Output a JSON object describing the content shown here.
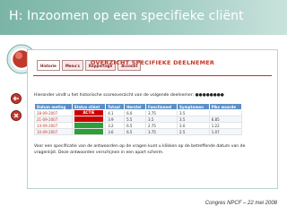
{
  "slide": {
    "title": "H: Inzoomen op een specifieke cliënt",
    "footer": "Congres  NPCF – 22  mei 2008"
  },
  "app": {
    "heading": "OVERZICHT SPECIFIEKE DEELNEMER",
    "tabs": [
      {
        "label": "Historie",
        "active": true
      },
      {
        "label": "Menu's",
        "active": false
      },
      {
        "label": "Rapportage",
        "active": false
      },
      {
        "label": "Account",
        "active": false
      }
    ],
    "intro": "Hieronder vindt u het historische scoreoverzicht van de volgende deelnemer:",
    "participant": "●●●●●●●●",
    "table": {
      "headers": [
        "Datum meting",
        "Status cliënt",
        "Totaal",
        "Herstel",
        "Functioneel",
        "Symptomen",
        "Piks waarde"
      ],
      "rows": [
        {
          "date": "28-09-2007",
          "status_label": "ACTIE",
          "status_color": "#cc0000",
          "totaal": "4.1",
          "herstel": "6.0",
          "functioneel": "3.75",
          "symptomen": "3.5",
          "piks": ""
        },
        {
          "date": "21-09-2007",
          "status_label": "",
          "status_color": "#cc0000",
          "totaal": "3.9",
          "herstel": "5.5",
          "functioneel": "3.5",
          "symptomen": "3.5",
          "piks": "6.85"
        },
        {
          "date": "14-09-2007",
          "status_label": "",
          "status_color": "#2e9e3a",
          "totaal": "3.2",
          "herstel": "6.5",
          "functioneel": "2.75",
          "symptomen": "3.0",
          "piks": "1.22"
        },
        {
          "date": "10-09-2007",
          "status_label": "",
          "status_color": "#2e9e3a",
          "totaal": "3.6",
          "herstel": "6.5",
          "functioneel": "3.75",
          "symptomen": "2.5",
          "piks": "1.07"
        }
      ]
    },
    "note": "Voor een specificatie van de antwoorden op de vragen kunt u klikken op de betreffende datum van de vragenlijst. Deze antwoorden verschijnen in een apart scherm."
  },
  "colors": {
    "title_bar": "#8ec1b4",
    "accent_red": "#c0392b",
    "table_header": "#5b8fc7"
  },
  "icons": [
    "magnifier-icon",
    "back-arrow-icon",
    "close-icon"
  ]
}
